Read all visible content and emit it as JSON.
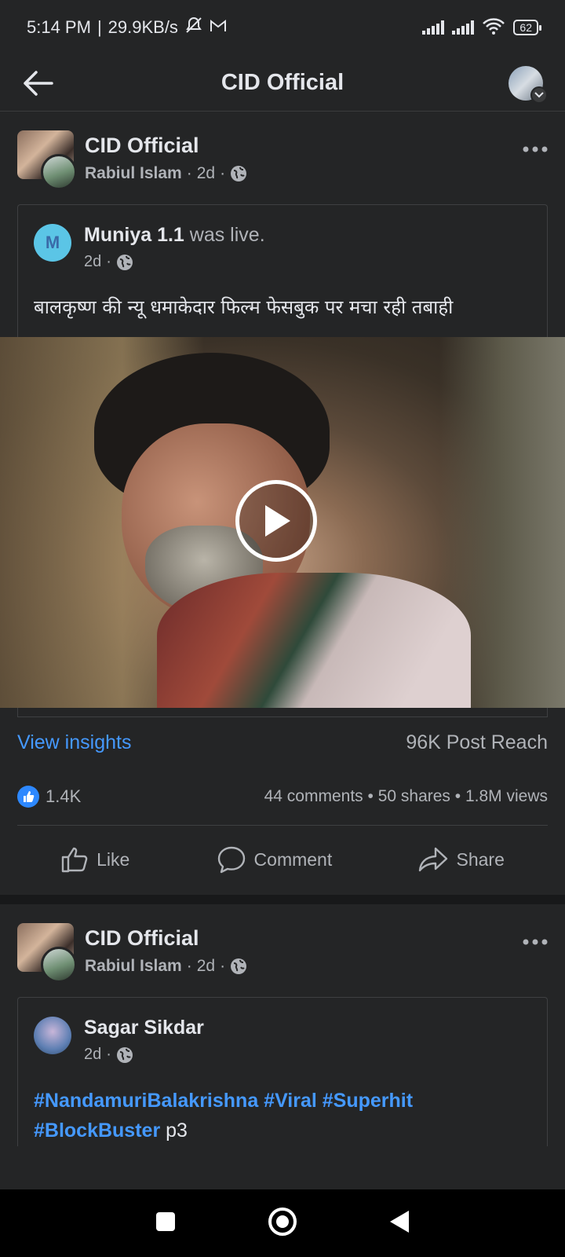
{
  "status_bar": {
    "time": "5:14 PM",
    "speed": "29.9KB/s",
    "battery": "62"
  },
  "app_bar": {
    "title": "CID Official"
  },
  "post1": {
    "page_name": "CID Official",
    "author": "Rabiul Islam",
    "time": "2d",
    "shared": {
      "avatar_letter": "M",
      "name": "Muniya 1.1",
      "action": "was live.",
      "time": "2d",
      "text": "बालकृष्ण की न्यू धमाकेदार फिल्म फेसबुक पर मचा रही तबाही"
    },
    "view_insights": "View insights",
    "reach": "96K Post Reach",
    "likes": "1.4K",
    "comments": "44 comments",
    "shares": "50 shares",
    "views": "1.8M views",
    "actions": {
      "like": "Like",
      "comment": "Comment",
      "share": "Share"
    }
  },
  "post2": {
    "page_name": "CID Official",
    "author": "Rabiul Islam",
    "time": "2d",
    "shared": {
      "name": "Sagar Sikdar",
      "time": "2d",
      "hashtags_line1": "#NandamuriBalakrishna #Viral #Superhit",
      "hashtags_line2_tag": "#BlockBuster",
      "hashtags_line2_text": " p3"
    }
  },
  "colors": {
    "background": "#242526",
    "link": "#4599ff",
    "like_blue": "#2d88ff"
  },
  "icons": [
    "back-arrow-icon",
    "globe-icon",
    "more-icon",
    "play-icon",
    "like-icon",
    "comment-icon",
    "share-icon",
    "thumbs-up-icon",
    "square-nav-icon",
    "circle-nav-icon",
    "triangle-nav-icon"
  ]
}
